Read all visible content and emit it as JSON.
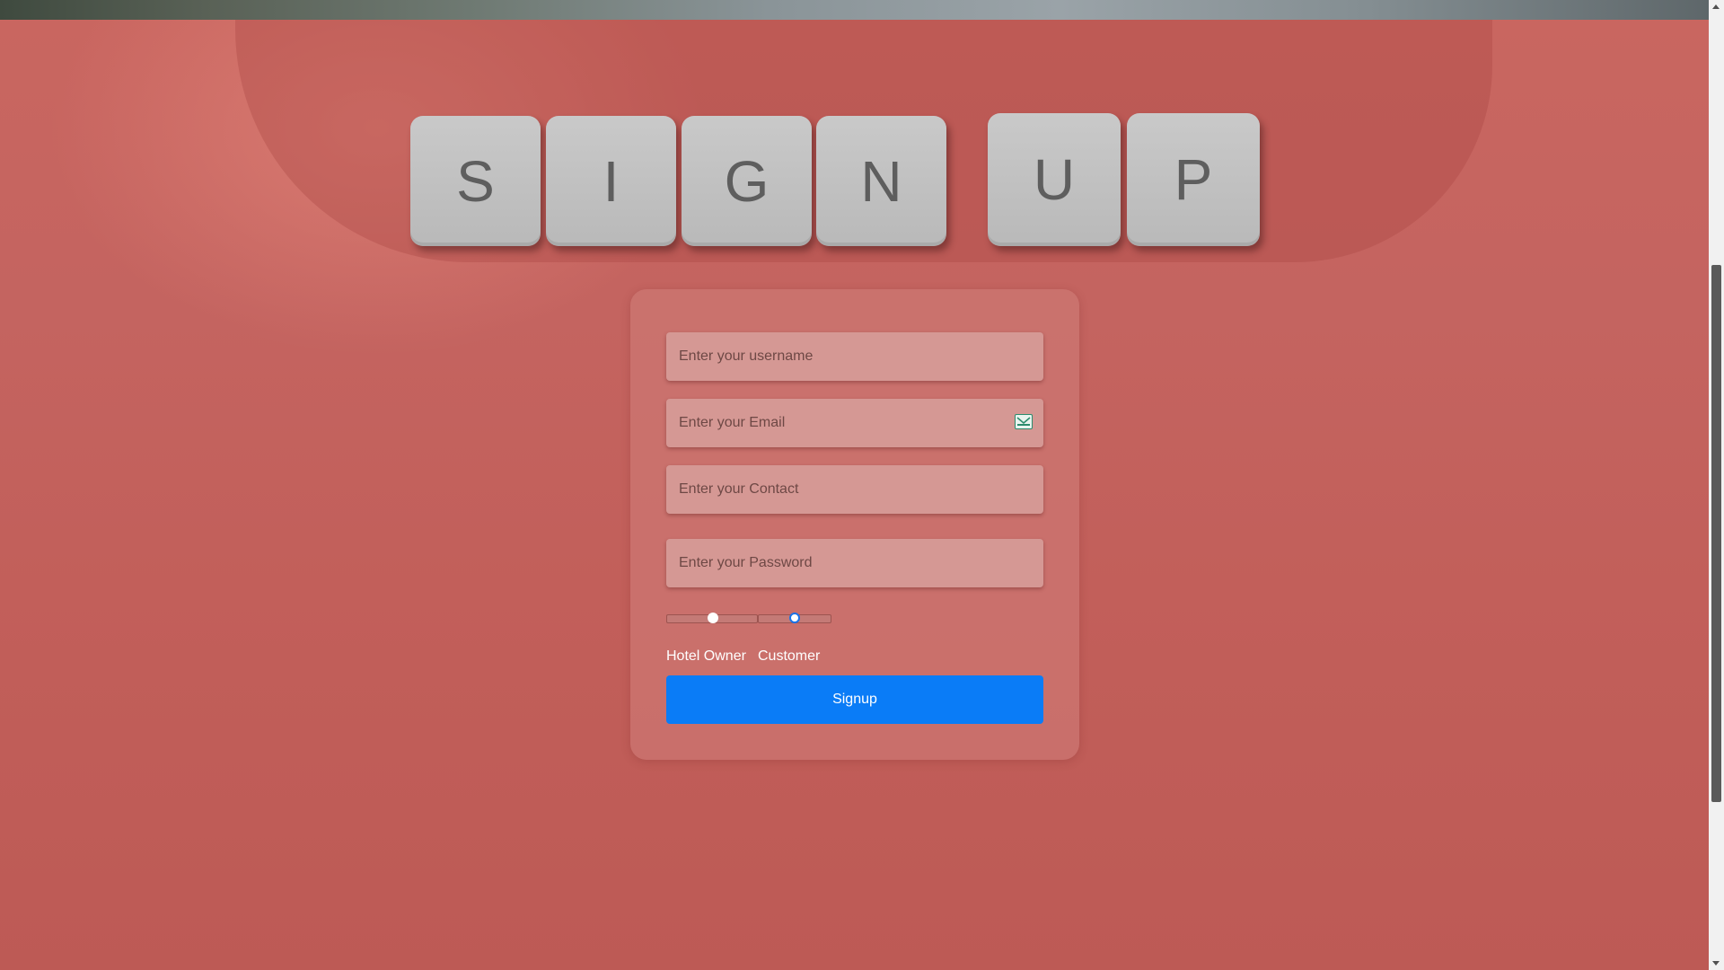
{
  "title_keys": {
    "word1": [
      "S",
      "I",
      "G",
      "N"
    ],
    "word2": [
      "U",
      "P"
    ]
  },
  "form": {
    "username_placeholder": "Enter your username",
    "email_placeholder": "Enter your Email",
    "contact_placeholder": "Enter your Contact",
    "password_placeholder": "Enter your Password",
    "role_options": [
      "Hotel Owner",
      "Customer"
    ],
    "selected_role": "Customer",
    "submit_label": "Signup",
    "email_icon": "mail-icon"
  },
  "colors": {
    "background": "#c0605a",
    "card": "#cd7873",
    "field": "#d59894",
    "submit": "#0a7cf7",
    "key": "#c0c0c0"
  }
}
